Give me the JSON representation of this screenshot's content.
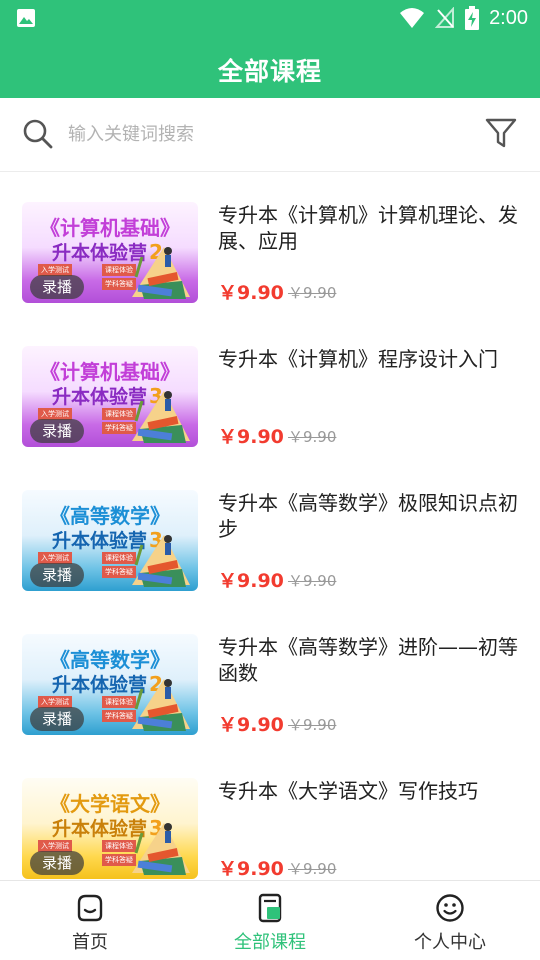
{
  "status_bar": {
    "time": "2:00"
  },
  "header": {
    "title": "全部课程"
  },
  "search": {
    "placeholder": "输入关键词搜索"
  },
  "courses": [
    {
      "thumb": {
        "line1": "《计算机基础》",
        "line2": "升本体验营",
        "num": "2",
        "theme": "purple",
        "tags": [
          "入学测试",
          "课程体验",
          "学科答疑"
        ],
        "badge": "录播"
      },
      "title": "专升本《计算机》计算机理论、发展、应用",
      "price": "￥9.90",
      "original_price": "￥9.90"
    },
    {
      "thumb": {
        "line1": "《计算机基础》",
        "line2": "升本体验营",
        "num": "3",
        "theme": "purple",
        "tags": [
          "入学测试",
          "课程体验",
          "学科答疑"
        ],
        "badge": "录播"
      },
      "title": "专升本《计算机》程序设计入门",
      "price": "￥9.90",
      "original_price": "￥9.90"
    },
    {
      "thumb": {
        "line1": "《高等数学》",
        "line2": "升本体验营",
        "num": "3",
        "theme": "blue",
        "tags": [
          "入学测试",
          "课程体验",
          "学科答疑"
        ],
        "badge": "录播"
      },
      "title": "专升本《高等数学》极限知识点初步",
      "price": "￥9.90",
      "original_price": "￥9.90"
    },
    {
      "thumb": {
        "line1": "《高等数学》",
        "line2": "升本体验营",
        "num": "2",
        "theme": "blue",
        "tags": [
          "入学测试",
          "课程体验",
          "学科答疑"
        ],
        "badge": "录播"
      },
      "title": "专升本《高等数学》进阶——初等函数",
      "price": "￥9.90",
      "original_price": "￥9.90"
    },
    {
      "thumb": {
        "line1": "《大学语文》",
        "line2": "升本体验营",
        "num": "3",
        "theme": "yellow",
        "tags": [
          "入学测试",
          "课程体验",
          "学科答疑"
        ],
        "badge": "录播"
      },
      "title": "专升本《大学语文》写作技巧",
      "price": "￥9.90",
      "original_price": "￥9.90"
    }
  ],
  "bottom_nav": [
    {
      "label": "首页",
      "icon": "home-icon",
      "active": false
    },
    {
      "label": "全部课程",
      "icon": "courses-icon",
      "active": true
    },
    {
      "label": "个人中心",
      "icon": "profile-icon",
      "active": false
    }
  ],
  "colors": {
    "brand": "#2fc27a",
    "price": "#f23b2f",
    "num": "#f2a01d"
  }
}
